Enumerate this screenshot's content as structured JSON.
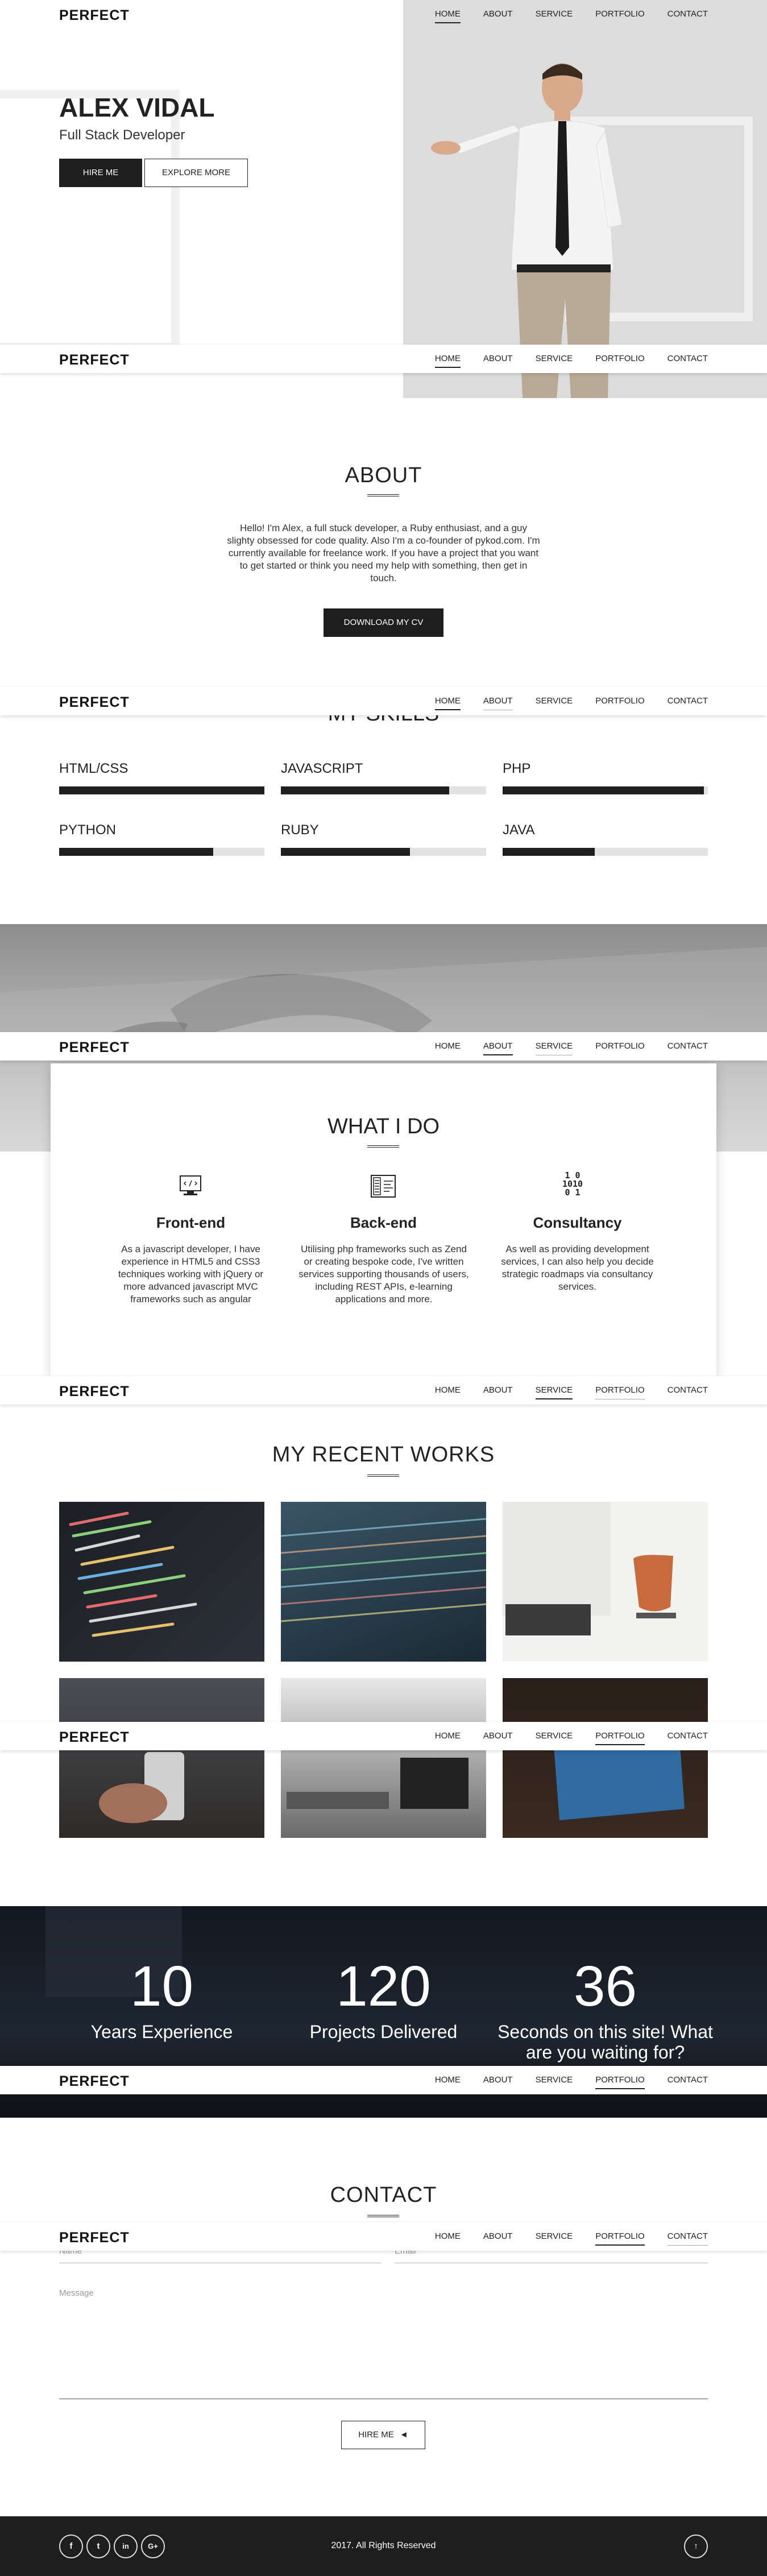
{
  "brand": {
    "logo": "PERFECT"
  },
  "nav": [
    "HOME",
    "ABOUT",
    "SERVICE",
    "PORTFOLIO",
    "CONTACT"
  ],
  "hero": {
    "name": "ALEX VIDAL",
    "role": "Full Stack Developer",
    "hire_btn": "HIRE ME",
    "explore_btn": "EXPLORE MORE"
  },
  "about": {
    "title": "ABOUT",
    "text": "Hello! I'm Alex, a full stuck developer, a Ruby enthusiast, and a guy slighty obsessed for code quality. Also I'm a co-founder of pykod.com. I'm currently available for freelance work. If you have a project that you want to get started or think you need my help with something, then get in touch.",
    "button": "DOWNLOAD MY CV"
  },
  "skills": {
    "title": "MY SKILLS",
    "items": [
      {
        "name": "HTML/CSS",
        "level": 1.0
      },
      {
        "name": "JAVASCRIPT",
        "level": 0.82
      },
      {
        "name": "PHP",
        "level": 0.98
      },
      {
        "name": "PYTHON",
        "level": 0.75
      },
      {
        "name": "RUBY",
        "level": 0.63
      },
      {
        "name": "JAVA",
        "level": 0.45
      }
    ]
  },
  "services": {
    "title": "WHAT I DO",
    "items": [
      {
        "icon": "monitor-code-icon",
        "title": "Front-end",
        "text": "As a javascript developer, I have experience in HTML5 and CSS3 techniques working with jQuery or more advanced javascript MVC frameworks such as angular"
      },
      {
        "icon": "server-code-icon",
        "title": "Back-end",
        "text": "Utilising php frameworks such as Zend or creating bespoke code, I've written services supporting thousands of users, including REST APIs, e-learning applications and more."
      },
      {
        "icon": "binary-icon",
        "title": "Consultancy",
        "binary": "1 0\n1010\n0 1",
        "text": "As well as providing development services, I can also help you decide strategic roadmaps via consultancy services."
      }
    ]
  },
  "works": {
    "title": "MY RECENT WORKS"
  },
  "stats": [
    {
      "number": "10",
      "label": "Years Experience"
    },
    {
      "number": "120",
      "label": "Projects Delivered"
    },
    {
      "number": "36",
      "label": "Seconds on this site! What are you waiting for?"
    }
  ],
  "contact": {
    "title": "CONTACT",
    "name_label": "Name",
    "email_label": "Email",
    "message_label": "Message",
    "button": "HIRE ME"
  },
  "footer": {
    "copyright": "2017. All Rights Reserved",
    "socials": [
      "f",
      "t",
      "in",
      "G+"
    ]
  },
  "colors": {
    "dark": "#1e1e1e",
    "light_gray": "#dcdcdc",
    "track": "#e2e2e2"
  }
}
